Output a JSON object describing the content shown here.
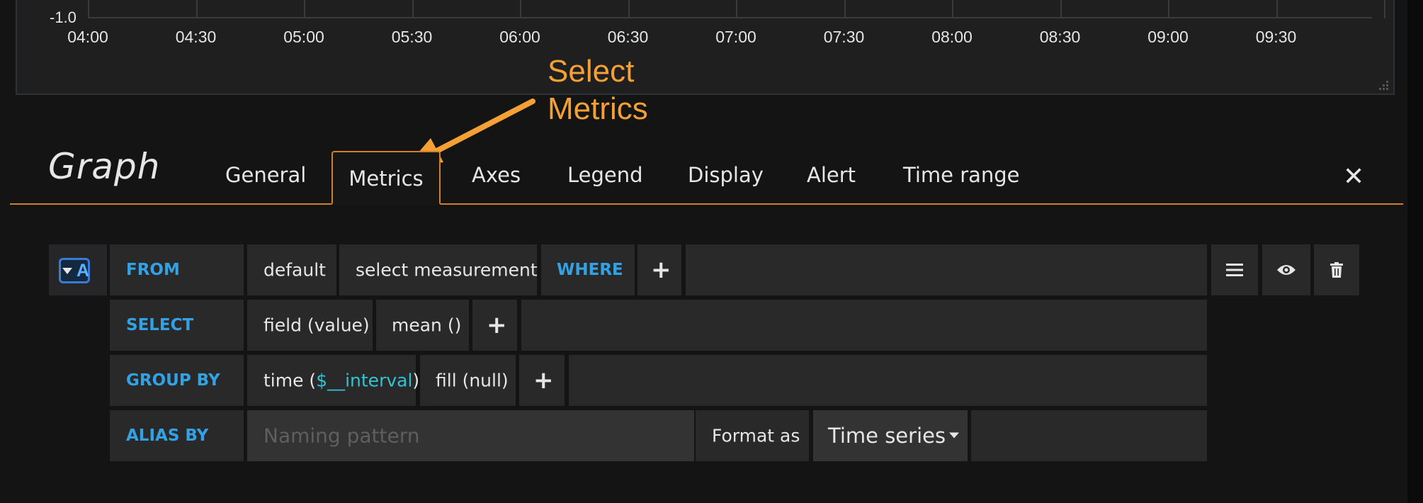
{
  "graph": {
    "y_ticks": [
      "-1.0"
    ],
    "x_ticks": [
      "04:00",
      "04:30",
      "05:00",
      "05:30",
      "06:00",
      "06:30",
      "07:00",
      "07:30",
      "08:00",
      "08:30",
      "09:00",
      "09:30"
    ]
  },
  "annotation": {
    "line1": "Select",
    "line2": "Metrics",
    "color": "#f5a035"
  },
  "editor": {
    "title": "Graph",
    "tabs": [
      "General",
      "Metrics",
      "Axes",
      "Legend",
      "Display",
      "Alert",
      "Time range"
    ],
    "active_tab": "Metrics",
    "close_icon": "close-icon",
    "accent_color": "#d17f29"
  },
  "query": {
    "ref_id": "A",
    "from_label": "FROM",
    "policy": "default",
    "measurement": "select measurement",
    "where_label": "WHERE",
    "plus": "+",
    "select_label": "SELECT",
    "field": "field (value)",
    "aggregation": "mean ()",
    "group_by_label": "GROUP BY",
    "time_prefix": "time (",
    "time_interval": "$__interval",
    "time_suffix": ")",
    "fill": "fill (null)",
    "alias_label": "ALIAS BY",
    "alias_placeholder": "Naming pattern",
    "format_label": "Format as",
    "format_value": "Time series",
    "row_icons": [
      "menu-icon",
      "eye-icon",
      "trash-icon"
    ],
    "label_color": "#33a2e5"
  }
}
